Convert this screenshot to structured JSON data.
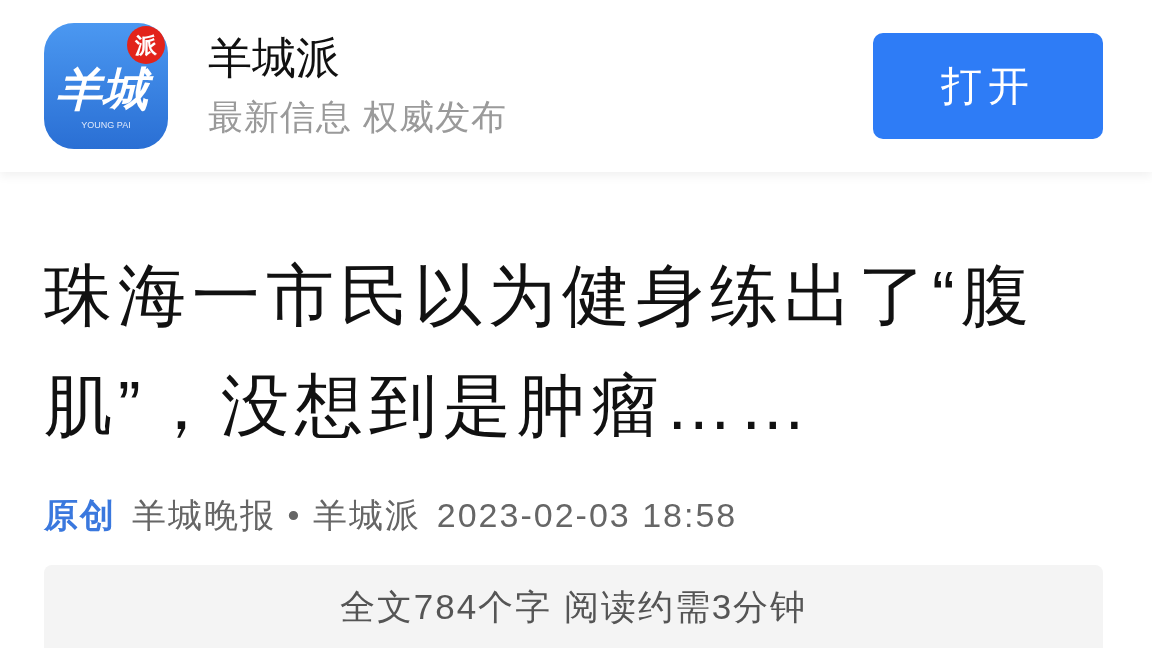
{
  "app_banner": {
    "logo": {
      "main_text": "羊城",
      "badge_text": "派",
      "tagline": "YOUNG PAI"
    },
    "name": "羊城派",
    "slogan": "最新信息 权威发布",
    "open_button": "打开"
  },
  "article": {
    "headline": "珠海一市民以为健身练出了“腹肌”，没想到是肿瘤……",
    "meta": {
      "tag": "原创",
      "source": "羊城晚报 • 羊城派",
      "published": "2023-02-03 18:58"
    },
    "reading_info": "全文784个字 阅读约需3分钟"
  }
}
